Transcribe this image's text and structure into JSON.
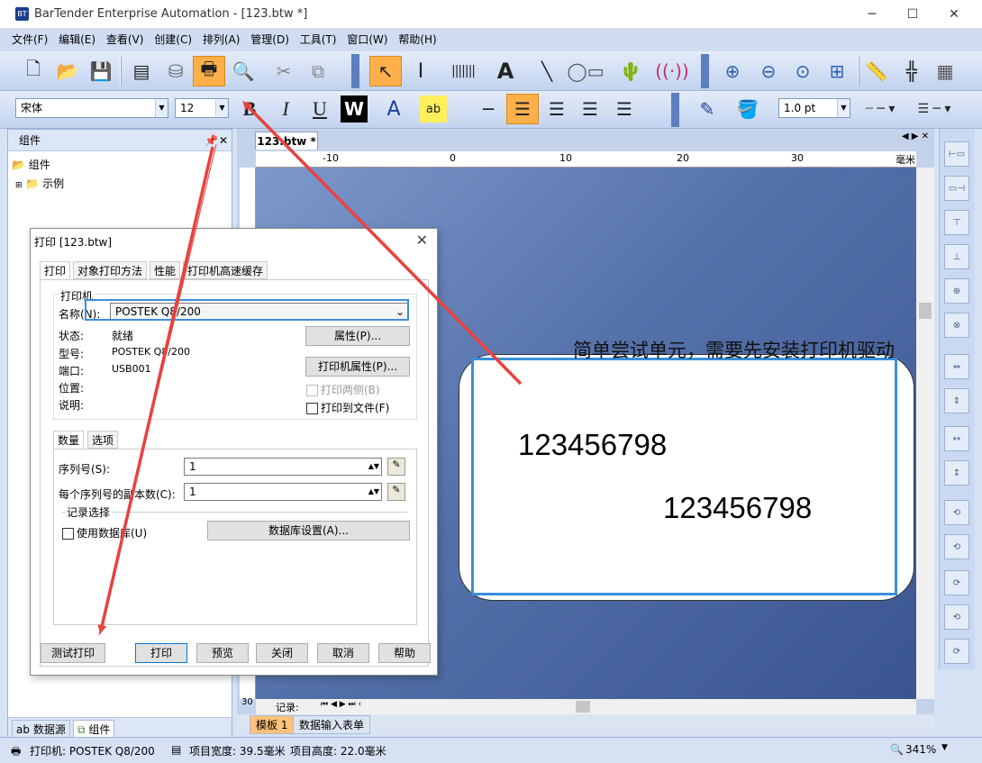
{
  "window": {
    "title": "BarTender Enterprise Automation - [123.btw *]"
  },
  "menu": [
    "文件(F)",
    "编辑(E)",
    "查看(V)",
    "创建(C)",
    "排列(A)",
    "管理(D)",
    "工具(T)",
    "窗口(W)",
    "帮助(H)"
  ],
  "format": {
    "font": "宋体",
    "size": "12",
    "line_width": "1.0 pt"
  },
  "left_panel": {
    "title": "组件",
    "root": "组件",
    "child": "示例",
    "tabs": [
      "数据源",
      "组件"
    ]
  },
  "document": {
    "tab": "123.btw *",
    "ruler_labels": [
      "-10",
      "0",
      "10",
      "20",
      "30",
      "毫米"
    ],
    "label_lines": [
      "123456798",
      "123456798"
    ],
    "bottom_tabs": [
      "模板 1",
      "数据输入表单"
    ],
    "record_label": "记录:",
    "vertical_ruler_label": "30"
  },
  "annotation": "简单尝试单元，需要先安装打印机驱动",
  "status": {
    "printer": "打印机: POSTEK Q8/200",
    "width": "项目宽度: 39.5毫米",
    "height": "项目高度: 22.0毫米",
    "zoom": "341%"
  },
  "dialog": {
    "title": "打印 [123.btw]",
    "tabs": [
      "打印",
      "对象打印方法",
      "性能",
      "打印机高速缓存"
    ],
    "printer_group": "打印机",
    "name_label": "名称(N):",
    "name_value": "POSTEK Q8/200",
    "status_label": "状态:",
    "status_value": "就绪",
    "model_label": "型号:",
    "model_value": "POSTEK Q8/200",
    "port_label": "端口:",
    "port_value": "USB001",
    "location_label": "位置:",
    "comment_label": "说明:",
    "properties_button": "属性(P)...",
    "printer_props_button": "打印机属性(P)...",
    "duplex_label": "打印两侧(B)",
    "print_to_file_label": "打印到文件(F)",
    "sub_tabs": [
      "数量",
      "选项"
    ],
    "serial_label": "序列号(S):",
    "serial_value": "1",
    "copies_label": "每个序列号的副本数(C):",
    "copies_value": "1",
    "record_group": "记录选择",
    "use_db_label": "使用数据库(U)",
    "db_settings_button": "数据库设置(A)...",
    "buttons": [
      "测试打印",
      "打印",
      "预览",
      "关闭",
      "取消",
      "帮助"
    ]
  },
  "colors": {
    "accent": "#3a8fd9",
    "arrow": "#e8423f"
  }
}
